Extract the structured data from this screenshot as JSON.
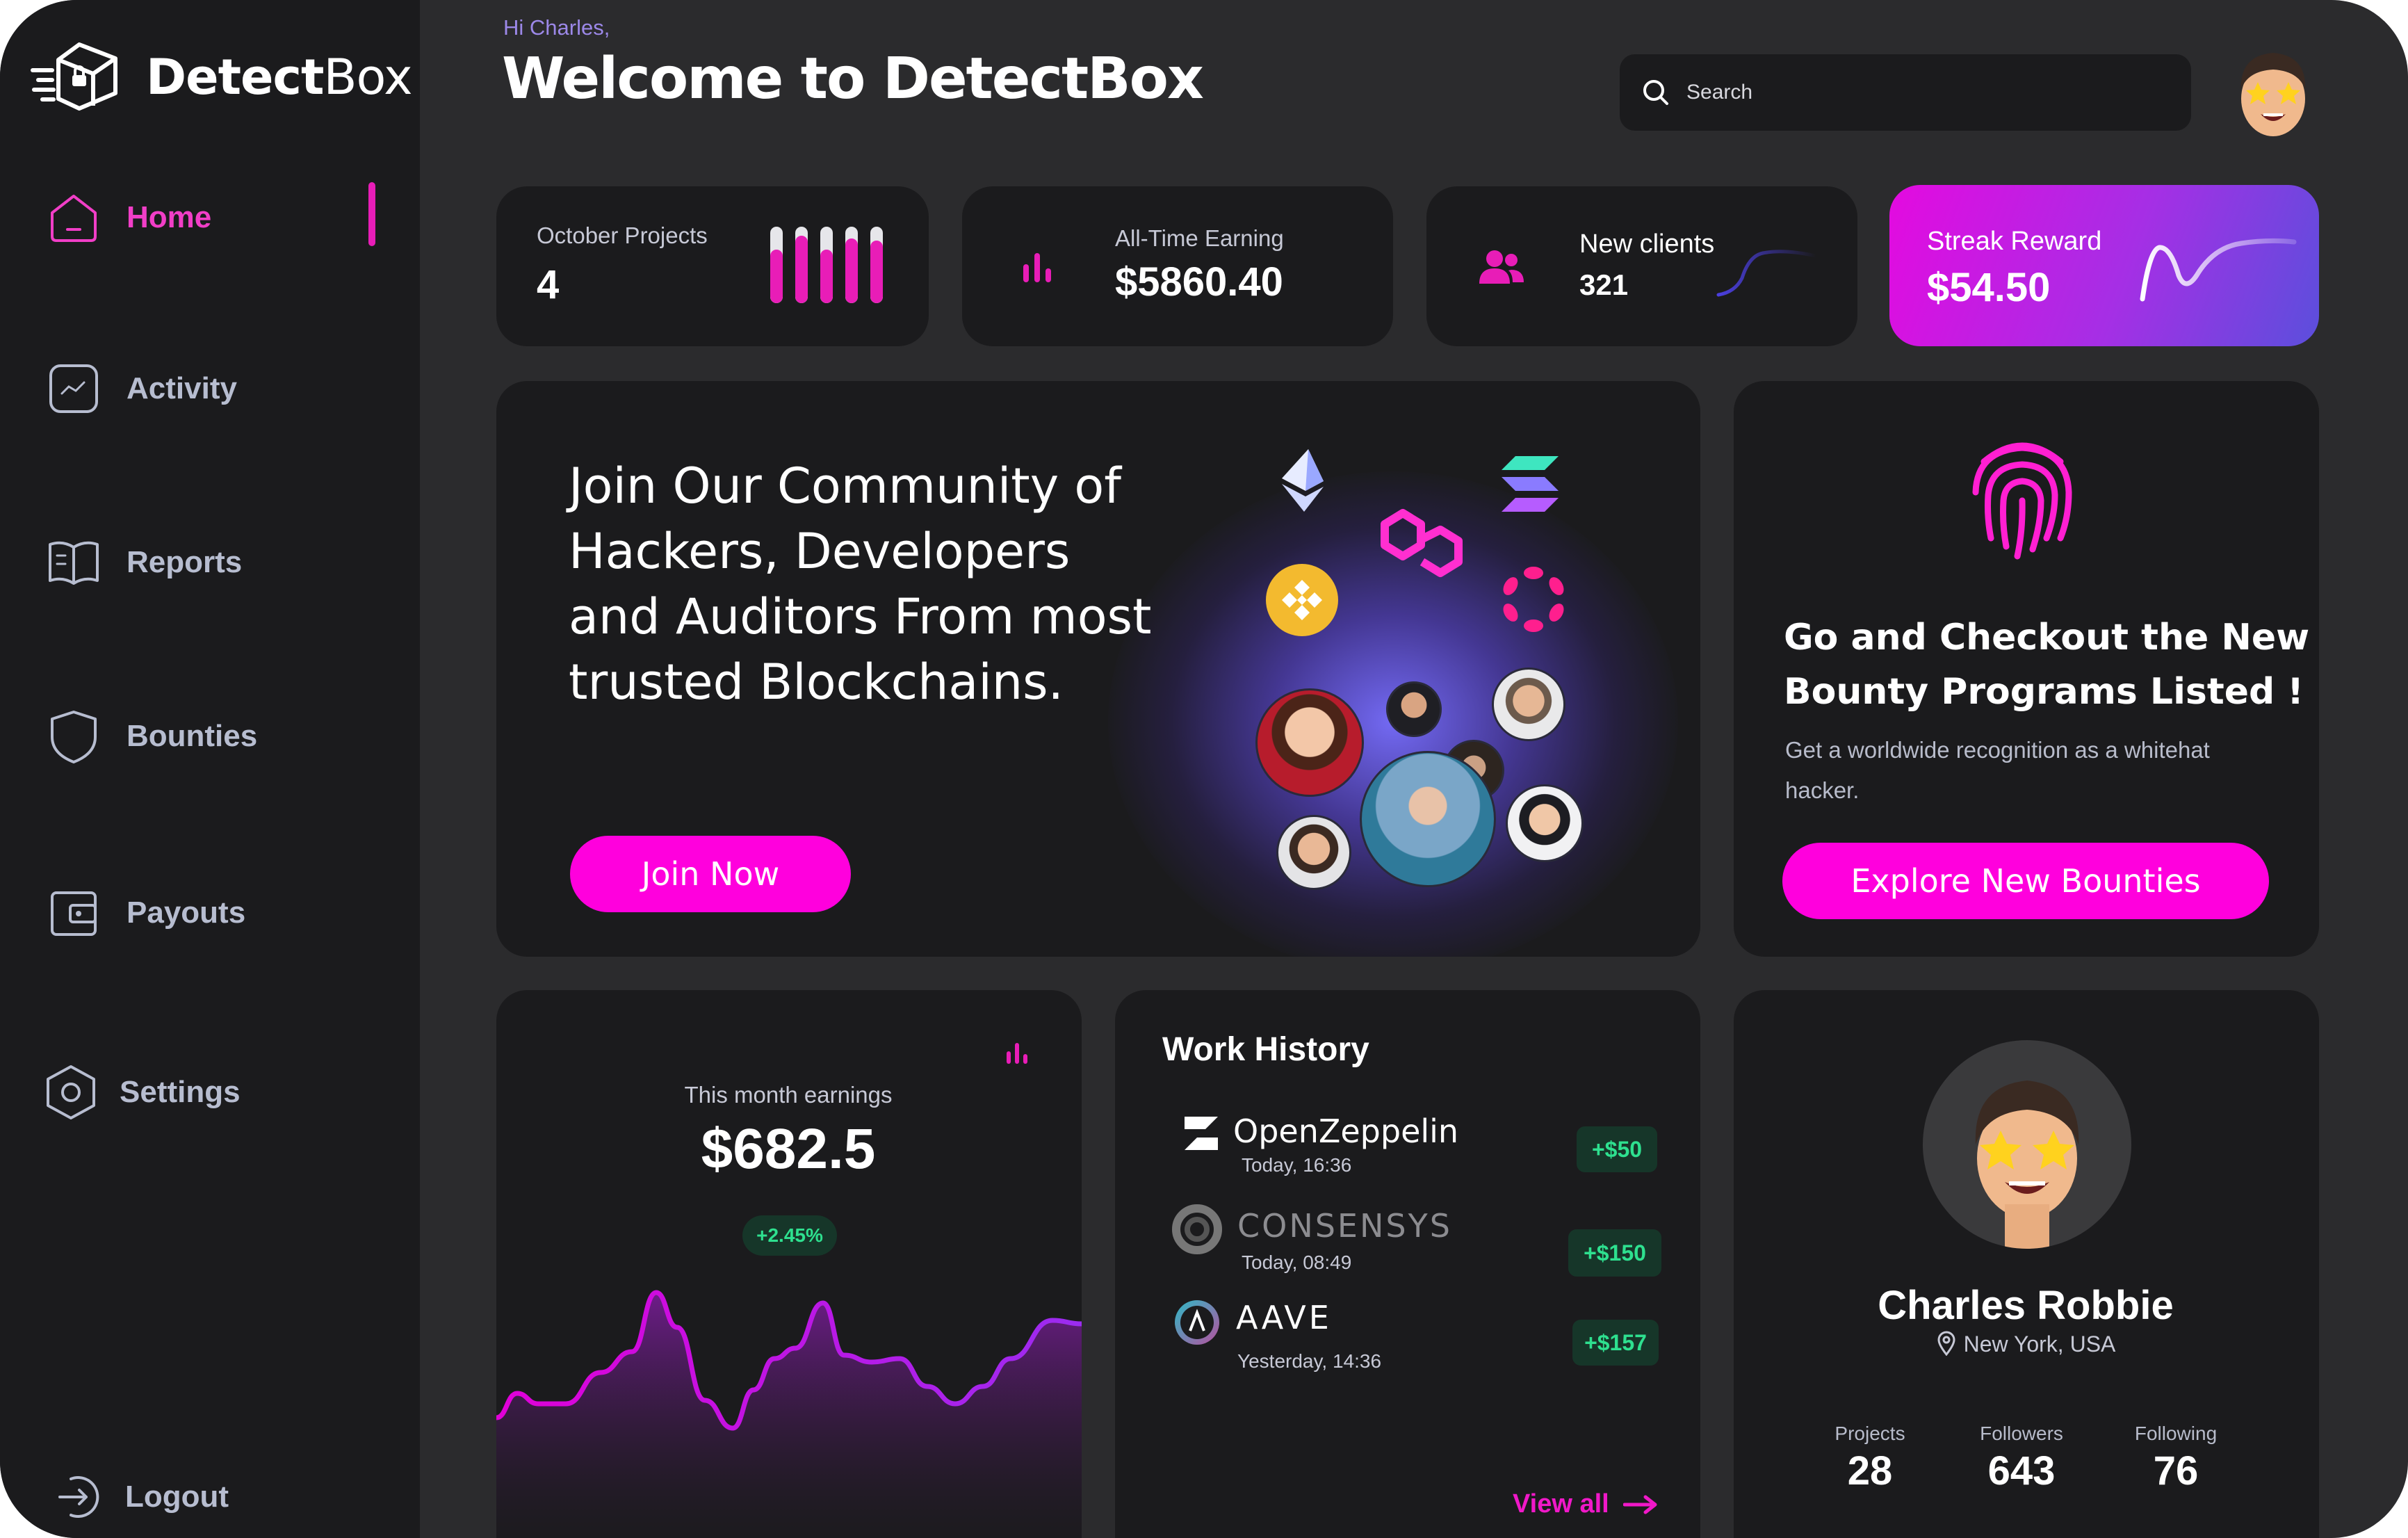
{
  "brand": {
    "name_bold": "Detect",
    "name_light": "Box"
  },
  "sidebar": {
    "items": [
      {
        "label": "Home",
        "icon": "home-icon",
        "active": true
      },
      {
        "label": "Activity",
        "icon": "activity-icon"
      },
      {
        "label": "Reports",
        "icon": "book-icon"
      },
      {
        "label": "Bounties",
        "icon": "shield-icon"
      },
      {
        "label": "Payouts",
        "icon": "wallet-icon"
      },
      {
        "label": "Settings",
        "icon": "hexagon-gear-icon"
      }
    ],
    "logout": "Logout"
  },
  "header": {
    "greeting": "Hi Charles,",
    "title": "Welcome to DetectBox",
    "search_placeholder": "Search"
  },
  "stats": {
    "projects": {
      "label": "October Projects",
      "value": "4",
      "bar_levels": [
        0.7,
        0.88,
        0.7,
        0.85,
        0.82
      ]
    },
    "earning": {
      "label": "All-Time Earning",
      "value": "$5860.40"
    },
    "clients": {
      "label": "New clients",
      "value": "321"
    },
    "streak": {
      "label": "Streak Reward",
      "value": "$54.50"
    }
  },
  "promo": {
    "text": "Join Our Community of Hackers, Developers and Auditors From most trusted Blockchains.",
    "button": "Join Now"
  },
  "bounty": {
    "title": "Go and Checkout the New Bounty Programs Listed !",
    "subtitle": "Get a worldwide recognition as a whitehat hacker.",
    "button": "Explore New Bounties"
  },
  "earnings": {
    "label": "This month earnings",
    "value": "$682.5",
    "change": "+2.45%"
  },
  "work_history": {
    "title": "Work History",
    "items": [
      {
        "name": "OpenZeppelin",
        "date": "Today, 16:36",
        "amount": "+$50"
      },
      {
        "name": "CONSENSYS",
        "date": "Today, 08:49",
        "amount": "+$150"
      },
      {
        "name": "AAVE",
        "date": "Yesterday, 14:36",
        "amount": "+$157"
      }
    ],
    "view_all": "View all"
  },
  "profile": {
    "name": "Charles Robbie",
    "location": "New York, USA",
    "stats": [
      {
        "label": "Projects",
        "value": "28"
      },
      {
        "label": "Followers",
        "value": "643"
      },
      {
        "label": "Following",
        "value": "76"
      }
    ]
  },
  "colors": {
    "accent": "#ff00dd",
    "sidebar": "#1b1b1d",
    "background": "#2b2b2d",
    "card": "#1b1b1d",
    "positive": "#2ee08f"
  }
}
